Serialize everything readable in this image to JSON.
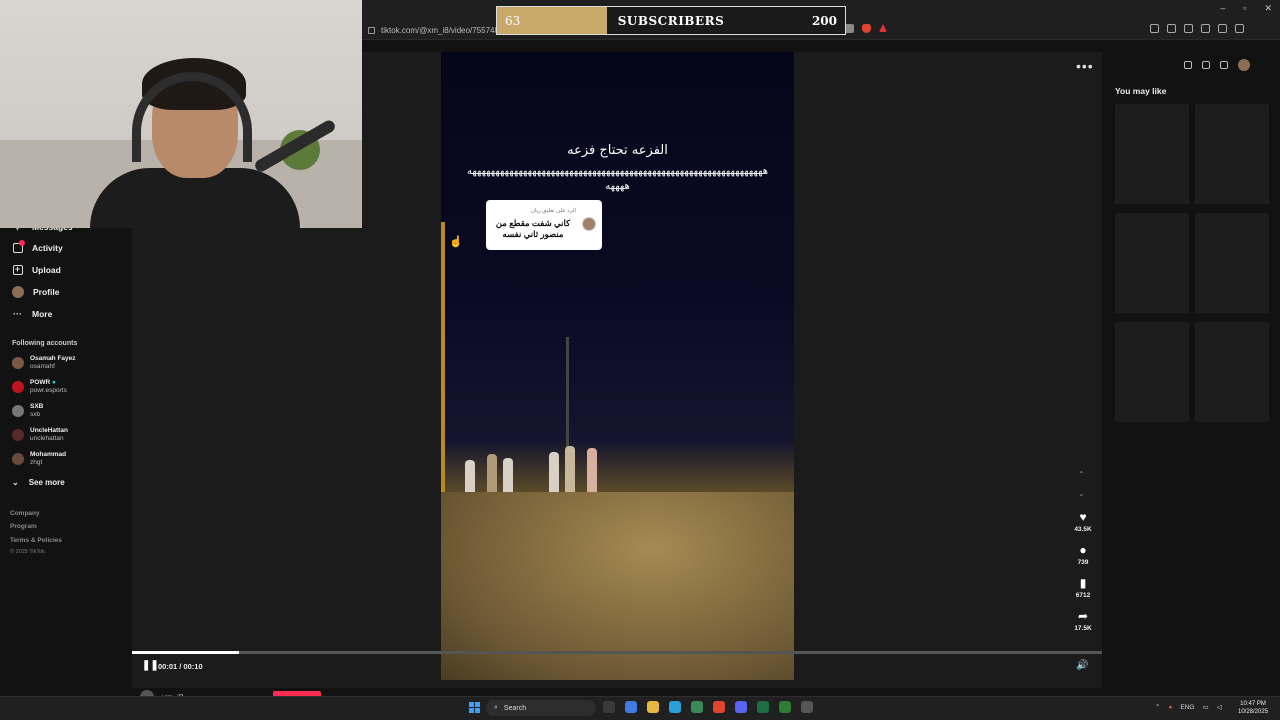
{
  "browser": {
    "url": "tiktok.com/@xm_i8/video/7557484"
  },
  "subscribers_widget": {
    "current": "63",
    "title": "SUBSCRIBERS",
    "goal": "200",
    "progress_fraction": 0.315,
    "fill_color": "#c9a96a"
  },
  "sidebar": {
    "nav": [
      {
        "label": "Messages",
        "icon": "messages-icon"
      },
      {
        "label": "Activity",
        "icon": "activity-icon"
      },
      {
        "label": "Upload",
        "icon": "upload-icon"
      },
      {
        "label": "Profile",
        "icon": "profile-avatar"
      },
      {
        "label": "More",
        "icon": "more-dots-icon"
      }
    ],
    "following_label": "Following accounts",
    "accounts": [
      {
        "name": "Osamah Fayez",
        "handle": "osamahf",
        "color": "#7a5a44"
      },
      {
        "name": "POWR",
        "handle": "powr.esports",
        "color": "#c0121f"
      },
      {
        "name": "SXB",
        "handle": "sxb",
        "color": "#777777"
      },
      {
        "name": "UncleHattan",
        "handle": "unclehattan",
        "color": "#5a2a2a"
      },
      {
        "name": "Mohammad",
        "handle": "zhgt",
        "color": "#6a4a3a"
      }
    ],
    "see_more": "See more",
    "footer": [
      "Company",
      "Program",
      "Terms & Policies"
    ],
    "copyright": "© 2025 TikTok"
  },
  "video": {
    "title_ar": "الفزعه تحتاج فزعه",
    "caption_line": "ههههههههههههههههههههههههههههههههههههههههههههههههههههههههههههههههه",
    "caption_line2": "ههههه",
    "comment_reply_label": "الرد على تعليق ريان",
    "comment_text": "كاني شفت مقطع من منصور ثاني نفسه",
    "time": "00:01 / 00:10",
    "progress_fraction": 0.11,
    "likes": "43.5K",
    "comments": "739",
    "saves": "6712",
    "shares": "17.5K",
    "author": "xm_i8"
  },
  "right_panel": {
    "title": "You may like"
  },
  "taskbar": {
    "search": "Search",
    "lang": "ENG",
    "time": "10:47 PM",
    "date": "10/28/2025"
  }
}
